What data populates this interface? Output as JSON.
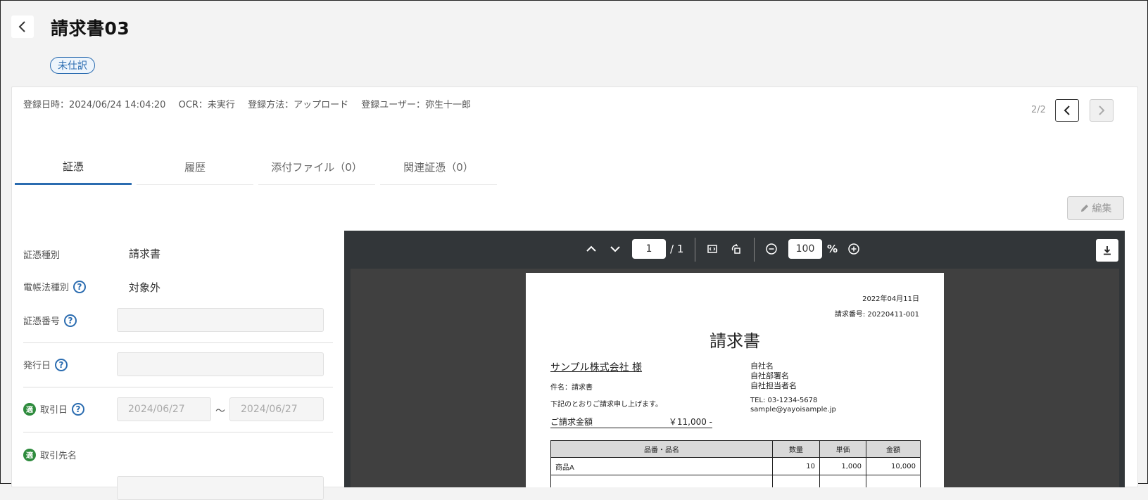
{
  "header": {
    "title": "請求書03",
    "status_badge": "未仕訳"
  },
  "meta": {
    "registered_at": "登録日時：2024/06/24 14:04:20",
    "ocr": "OCR：未実行",
    "method": "登録方法：アップロード",
    "user": "登録ユーザー：弥生十一郎"
  },
  "pager": {
    "count": "2/2"
  },
  "tabs": [
    {
      "label": "証憑"
    },
    {
      "label": "履歴"
    },
    {
      "label": "添付ファイル（0）"
    },
    {
      "label": "関連証憑（0）"
    }
  ],
  "toolbar": {
    "edit_label": "編集"
  },
  "form": {
    "doc_type_label": "証憑種別",
    "doc_type_value": "請求書",
    "ebook_label": "電帳法種別",
    "ebook_value": "対象外",
    "number_label": "証憑番号",
    "issue_date_label": "発行日",
    "tekiyo_icon": "適",
    "trade_date_label": "取引日",
    "trade_date_from": "2024/06/27",
    "trade_date_sep": "〜",
    "trade_date_to": "2024/06/27",
    "partner_label": "取引先名"
  },
  "viewer": {
    "page_input": "1",
    "page_total": "/ 1",
    "zoom_input": "100",
    "zoom_unit": "%"
  },
  "pdf": {
    "date": "2022年04月11日",
    "invoice_no": "請求番号: 20220411-001",
    "title": "請求書",
    "client": "サンプル株式会社 様",
    "subject": "件名：請求書",
    "greeting": "下記のとおりご請求申し上げます。",
    "amount_label": "ご請求金額",
    "amount_value": "￥11,000 -",
    "company_name": "自社名",
    "company_dept": "自社部署名",
    "company_person": "自社担当者名",
    "tel": "TEL: 03-1234-5678",
    "email": "sample@yayoisample.jp",
    "table_headers": [
      "品番・品名",
      "数量",
      "単価",
      "金額"
    ],
    "rows": [
      {
        "name": "商品A",
        "qty": "10",
        "price": "1,000",
        "amount": "10,000"
      }
    ]
  },
  "colors": {
    "accent": "#2b6cb0",
    "tekiyo": "#2e8b3d",
    "viewer_bg": "#323639"
  },
  "icons": [
    "back-arrow-icon",
    "chevron-left-icon",
    "chevron-right-icon",
    "pencil-icon",
    "help-icon",
    "chevron-up-icon",
    "chevron-down-icon",
    "fit-width-icon",
    "rotate-icon",
    "zoom-out-icon",
    "zoom-in-icon",
    "download-icon"
  ]
}
